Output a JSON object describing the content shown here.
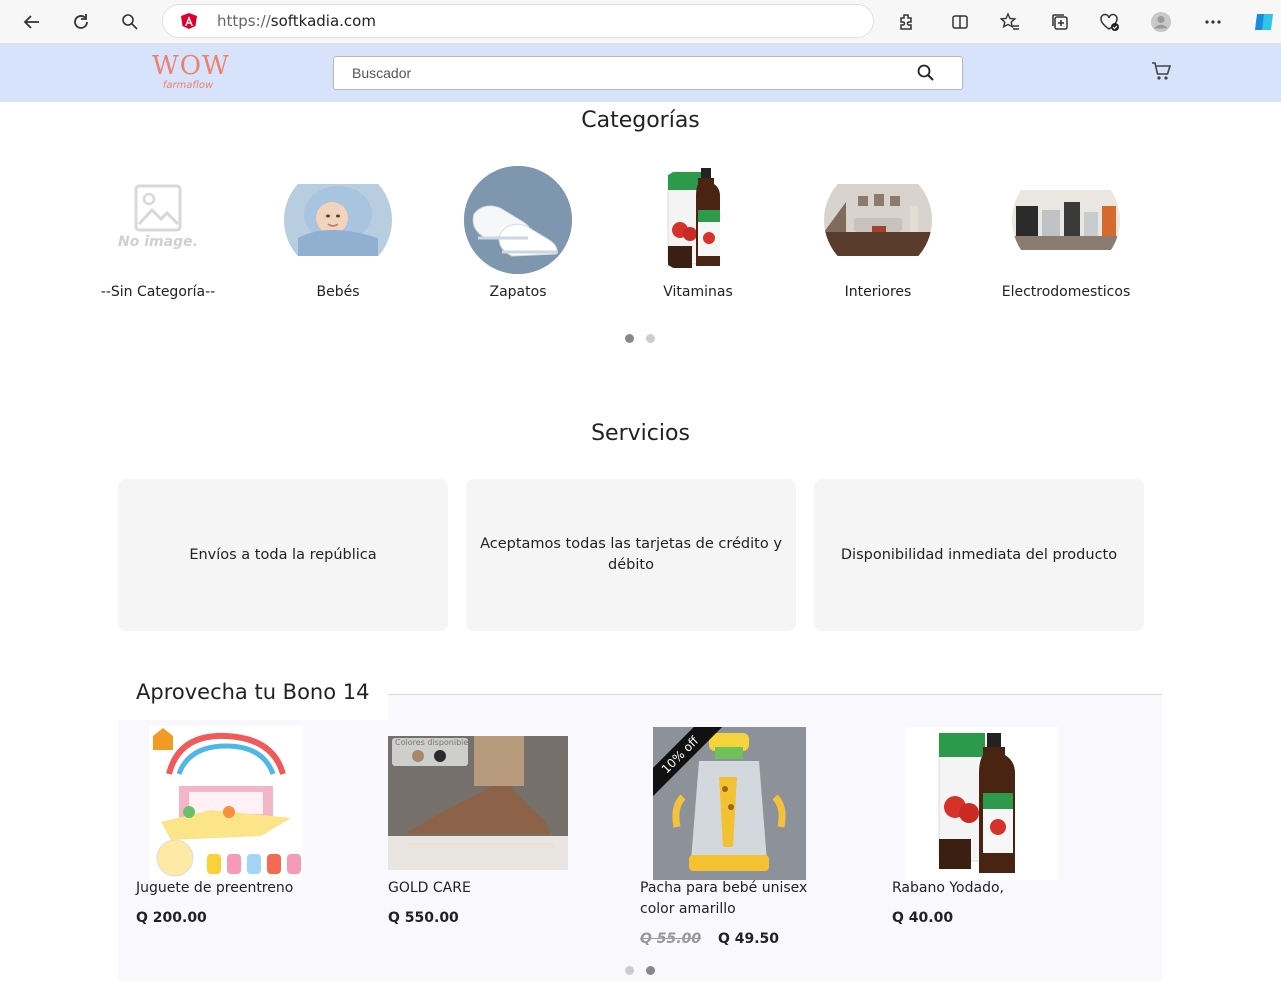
{
  "browser": {
    "url_protocol": "https://",
    "url_host": "softkadia.com"
  },
  "header": {
    "logo_main": "WOW",
    "logo_sub": "farmaflow",
    "search_placeholder": "Buscador"
  },
  "categories": {
    "title": "Categorías",
    "items": [
      {
        "label": "--Sin Categoría--",
        "no_image_text": "No image."
      },
      {
        "label": "Bebés"
      },
      {
        "label": "Zapatos"
      },
      {
        "label": "Vitaminas"
      },
      {
        "label": "Interiores"
      },
      {
        "label": "Electrodomesticos"
      }
    ],
    "pager": {
      "pages": 2,
      "active": 1
    }
  },
  "services": {
    "title": "Servicios",
    "items": [
      "Envíos a toda la república",
      "Aceptamos todas las tarjetas de crédito y débito",
      "Disponibilidad inmediata del producto"
    ]
  },
  "promo": {
    "title": "Aprovecha tu Bono 14",
    "products": [
      {
        "name": "Juguete de preentreno",
        "price": "Q 200.00"
      },
      {
        "name": "GOLD CARE",
        "price": "Q 550.00",
        "image_label": "Colores disponibles"
      },
      {
        "name": "Pacha para bebé unisex color amarillo",
        "old_price": "Q 55.00",
        "price": "Q 49.50",
        "badge": "10% off"
      },
      {
        "name": "Rabano Yodado,",
        "price": "Q 40.00"
      }
    ],
    "pager": {
      "pages": 2,
      "active": 2
    }
  },
  "colors": {
    "header_bg": "#d6e3fb",
    "logo": "#f0806e",
    "service_bg": "#f5f5f5"
  }
}
